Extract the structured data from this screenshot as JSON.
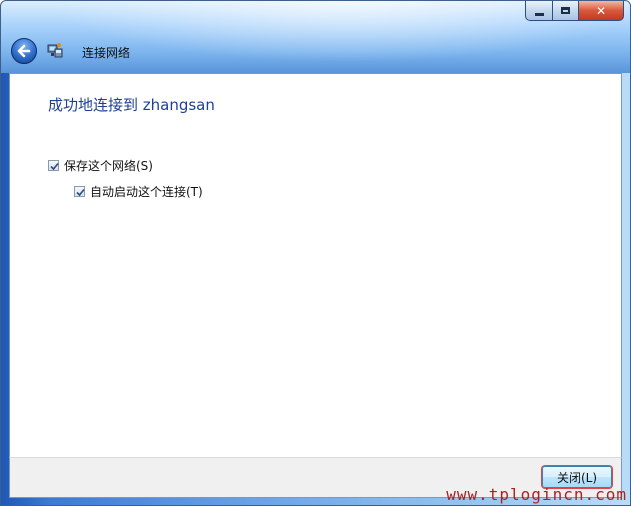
{
  "window": {
    "title": "连接网络",
    "caption_buttons": {
      "minimize_icon": "minimize-icon",
      "maximize_icon": "maximize-icon",
      "close_icon": "close-icon",
      "close_glyph": "✕"
    }
  },
  "nav": {
    "back_icon": "back-arrow-icon",
    "network_icon": "network-connection-icon"
  },
  "content": {
    "headline": "成功地连接到 zhangsan",
    "options": [
      {
        "label": "保存这个网络(S)",
        "checked": true
      },
      {
        "label": "自动启动这个连接(T)",
        "checked": true
      }
    ]
  },
  "footer": {
    "close_label": "关闭(L)"
  },
  "watermark": "www.tplogincn.com",
  "colors": {
    "headline": "#1e3f94",
    "focus_outline": "#e04848",
    "watermark": "#b02020"
  }
}
